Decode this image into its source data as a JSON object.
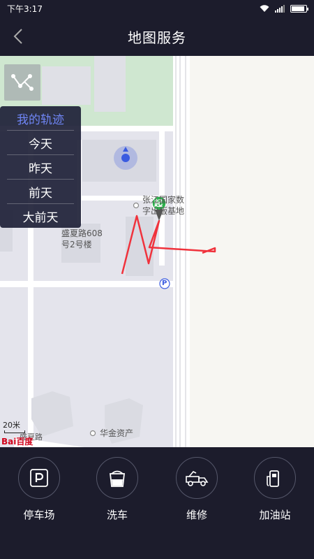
{
  "status_bar": {
    "time": "下午3:17"
  },
  "header": {
    "title": "地图服务"
  },
  "track_menu": {
    "title": "我的轨迹",
    "items": [
      "今天",
      "昨天",
      "前天",
      "大前天"
    ]
  },
  "map": {
    "poi_building": "盛夏路608\n号2号楼",
    "poi_base_line1": "张江国家数",
    "poi_base_line2": "字出版基地",
    "poi_huajin": "华金资产",
    "start_marker": "起",
    "road_label": "盛夏路",
    "scale": "20米",
    "logo": "Bai百度",
    "parking_sign": "P"
  },
  "services": [
    {
      "label": "停车场",
      "icon": "parking-icon"
    },
    {
      "label": "洗车",
      "icon": "car-wash-icon"
    },
    {
      "label": "维修",
      "icon": "tow-truck-icon"
    },
    {
      "label": "加油站",
      "icon": "gas-station-icon"
    }
  ],
  "colors": {
    "accent": "#6f85f5",
    "track": "#f0323c",
    "start_marker": "#2bb24c",
    "location": "#3a5be0"
  }
}
